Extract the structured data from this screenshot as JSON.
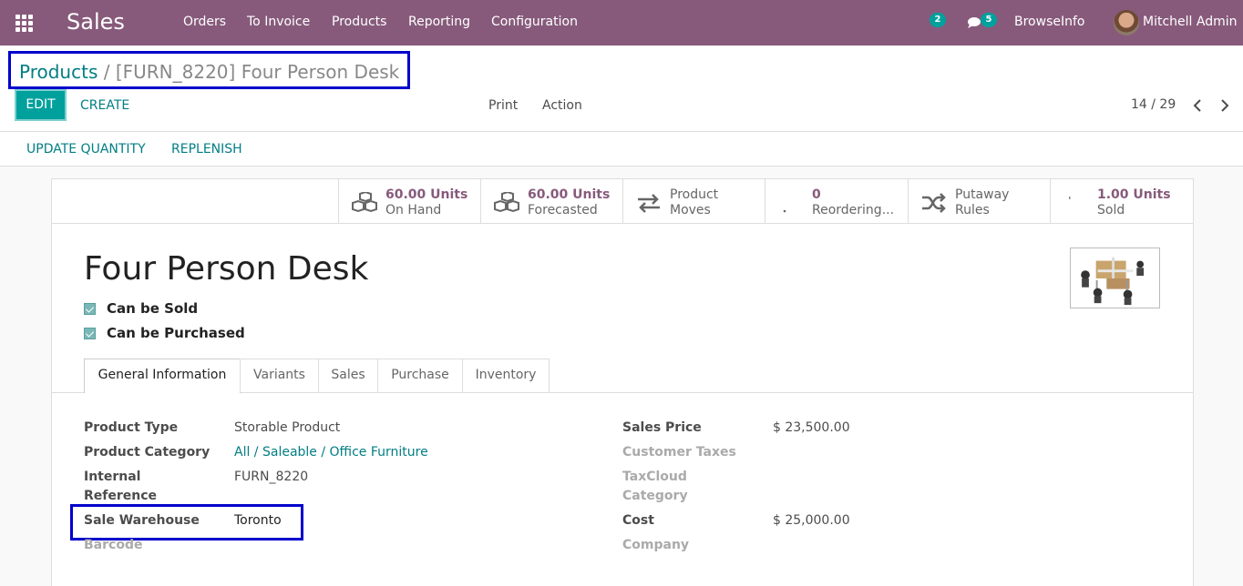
{
  "navbar": {
    "app_name": "Sales",
    "menu": [
      "Orders",
      "To Invoice",
      "Products",
      "Reporting",
      "Configuration"
    ],
    "activity_count": "2",
    "message_count": "5",
    "company": "BrowseInfo",
    "user": "Mitchell Admin"
  },
  "control": {
    "breadcrumb_root": "Products",
    "breadcrumb_sep": "/",
    "breadcrumb_current": "[FURN_8220] Four Person Desk",
    "edit_label": "EDIT",
    "create_label": "CREATE",
    "print_label": "Print",
    "action_label": "Action",
    "pager": "14 / 29"
  },
  "statusbar": {
    "update_quantity": "UPDATE QUANTITY",
    "replenish": "REPLENISH"
  },
  "smart_buttons": [
    {
      "line1": "60.00 Units",
      "line2": "On Hand",
      "icon": "cubes-icon"
    },
    {
      "line1": "60.00 Units",
      "line2": "Forecasted",
      "icon": "cubes-icon"
    },
    {
      "line1": "Product",
      "line2": "Moves",
      "icon": "exchange-icon"
    },
    {
      "line1": "0",
      "line2": "Reordering...",
      "icon": "refresh-icon"
    },
    {
      "line1": "Putaway",
      "line2": "Rules",
      "icon": "random-icon"
    },
    {
      "line1": "1.00 Units",
      "line2": "Sold",
      "icon": "signal-icon"
    }
  ],
  "product": {
    "name": "Four Person Desk",
    "can_be_sold": "Can be Sold",
    "can_be_purchased": "Can be Purchased"
  },
  "tabs": [
    "General Information",
    "Variants",
    "Sales",
    "Purchase",
    "Inventory"
  ],
  "fields_left": {
    "product_type_label": "Product Type",
    "product_type_value": "Storable Product",
    "product_category_label": "Product Category",
    "product_category_value": "All / Saleable / Office Furniture",
    "internal_reference_label_1": "Internal",
    "internal_reference_label_2": "Reference",
    "internal_reference_value": "FURN_8220",
    "sale_warehouse_label": "Sale Warehouse",
    "sale_warehouse_value": "Toronto",
    "barcode_label": "Barcode"
  },
  "fields_right": {
    "sales_price_label": "Sales Price",
    "sales_price_value": "$ 23,500.00",
    "customer_taxes_label": "Customer Taxes",
    "taxcloud_label_1": "TaxCloud",
    "taxcloud_label_2": "Category",
    "cost_label": "Cost",
    "cost_value": "$ 25,000.00",
    "company_label": "Company"
  },
  "colors": {
    "navbar": "#875a7b",
    "accent": "#00a09d",
    "link": "#017e84",
    "annotation": "#0000cc"
  }
}
